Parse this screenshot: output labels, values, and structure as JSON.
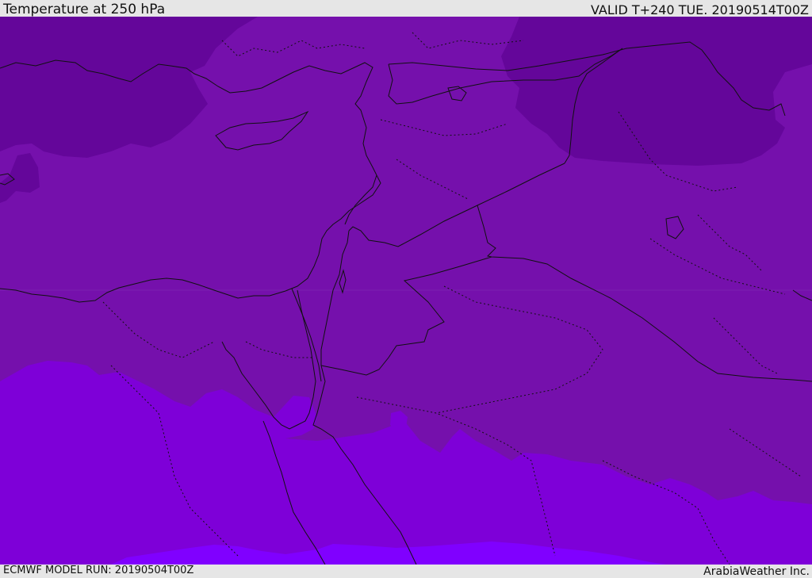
{
  "header": {
    "title": "Temperature at 250 hPa",
    "valid": "VALID T+240 TUE. 20190514T00Z"
  },
  "footer": {
    "model_run": "ECMWF MODEL RUN: 20190504T00Z",
    "credit": "ArabiaWeather Inc."
  },
  "map": {
    "region": "Eastern Mediterranean and Middle East",
    "layers": [
      "temperature-fill",
      "coastlines",
      "country-borders",
      "internal-borders"
    ]
  },
  "colors": {
    "band_cold": "#64069a",
    "band_mid": "#7510ac",
    "band_warm": "#7e00d8",
    "band_warmest": "#8000ff",
    "coastline": "#111111",
    "border": "#111111",
    "frame": "#e6e6e6"
  }
}
